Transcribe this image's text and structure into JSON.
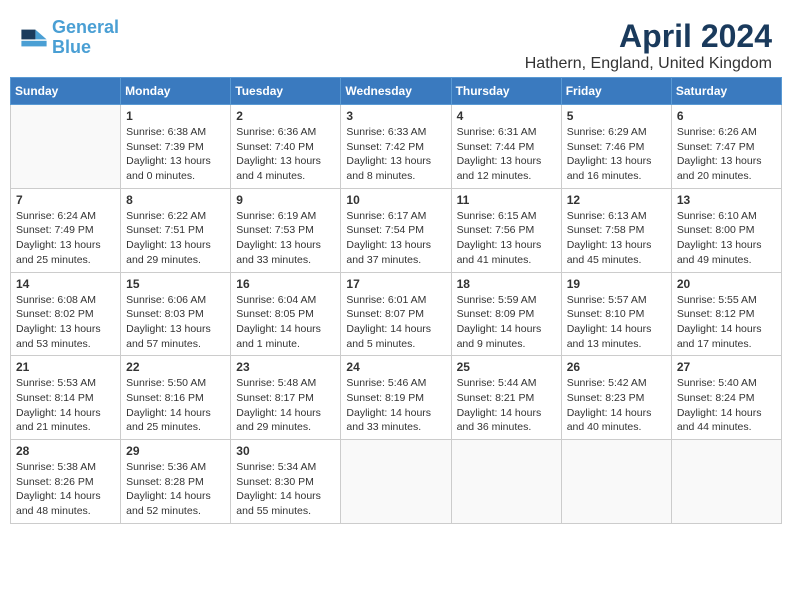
{
  "header": {
    "logo_line1": "General",
    "logo_line2": "Blue",
    "month": "April 2024",
    "location": "Hathern, England, United Kingdom"
  },
  "weekdays": [
    "Sunday",
    "Monday",
    "Tuesday",
    "Wednesday",
    "Thursday",
    "Friday",
    "Saturday"
  ],
  "weeks": [
    [
      {
        "day": "",
        "info": ""
      },
      {
        "day": "1",
        "info": "Sunrise: 6:38 AM\nSunset: 7:39 PM\nDaylight: 13 hours\nand 0 minutes."
      },
      {
        "day": "2",
        "info": "Sunrise: 6:36 AM\nSunset: 7:40 PM\nDaylight: 13 hours\nand 4 minutes."
      },
      {
        "day": "3",
        "info": "Sunrise: 6:33 AM\nSunset: 7:42 PM\nDaylight: 13 hours\nand 8 minutes."
      },
      {
        "day": "4",
        "info": "Sunrise: 6:31 AM\nSunset: 7:44 PM\nDaylight: 13 hours\nand 12 minutes."
      },
      {
        "day": "5",
        "info": "Sunrise: 6:29 AM\nSunset: 7:46 PM\nDaylight: 13 hours\nand 16 minutes."
      },
      {
        "day": "6",
        "info": "Sunrise: 6:26 AM\nSunset: 7:47 PM\nDaylight: 13 hours\nand 20 minutes."
      }
    ],
    [
      {
        "day": "7",
        "info": "Sunrise: 6:24 AM\nSunset: 7:49 PM\nDaylight: 13 hours\nand 25 minutes."
      },
      {
        "day": "8",
        "info": "Sunrise: 6:22 AM\nSunset: 7:51 PM\nDaylight: 13 hours\nand 29 minutes."
      },
      {
        "day": "9",
        "info": "Sunrise: 6:19 AM\nSunset: 7:53 PM\nDaylight: 13 hours\nand 33 minutes."
      },
      {
        "day": "10",
        "info": "Sunrise: 6:17 AM\nSunset: 7:54 PM\nDaylight: 13 hours\nand 37 minutes."
      },
      {
        "day": "11",
        "info": "Sunrise: 6:15 AM\nSunset: 7:56 PM\nDaylight: 13 hours\nand 41 minutes."
      },
      {
        "day": "12",
        "info": "Sunrise: 6:13 AM\nSunset: 7:58 PM\nDaylight: 13 hours\nand 45 minutes."
      },
      {
        "day": "13",
        "info": "Sunrise: 6:10 AM\nSunset: 8:00 PM\nDaylight: 13 hours\nand 49 minutes."
      }
    ],
    [
      {
        "day": "14",
        "info": "Sunrise: 6:08 AM\nSunset: 8:02 PM\nDaylight: 13 hours\nand 53 minutes."
      },
      {
        "day": "15",
        "info": "Sunrise: 6:06 AM\nSunset: 8:03 PM\nDaylight: 13 hours\nand 57 minutes."
      },
      {
        "day": "16",
        "info": "Sunrise: 6:04 AM\nSunset: 8:05 PM\nDaylight: 14 hours\nand 1 minute."
      },
      {
        "day": "17",
        "info": "Sunrise: 6:01 AM\nSunset: 8:07 PM\nDaylight: 14 hours\nand 5 minutes."
      },
      {
        "day": "18",
        "info": "Sunrise: 5:59 AM\nSunset: 8:09 PM\nDaylight: 14 hours\nand 9 minutes."
      },
      {
        "day": "19",
        "info": "Sunrise: 5:57 AM\nSunset: 8:10 PM\nDaylight: 14 hours\nand 13 minutes."
      },
      {
        "day": "20",
        "info": "Sunrise: 5:55 AM\nSunset: 8:12 PM\nDaylight: 14 hours\nand 17 minutes."
      }
    ],
    [
      {
        "day": "21",
        "info": "Sunrise: 5:53 AM\nSunset: 8:14 PM\nDaylight: 14 hours\nand 21 minutes."
      },
      {
        "day": "22",
        "info": "Sunrise: 5:50 AM\nSunset: 8:16 PM\nDaylight: 14 hours\nand 25 minutes."
      },
      {
        "day": "23",
        "info": "Sunrise: 5:48 AM\nSunset: 8:17 PM\nDaylight: 14 hours\nand 29 minutes."
      },
      {
        "day": "24",
        "info": "Sunrise: 5:46 AM\nSunset: 8:19 PM\nDaylight: 14 hours\nand 33 minutes."
      },
      {
        "day": "25",
        "info": "Sunrise: 5:44 AM\nSunset: 8:21 PM\nDaylight: 14 hours\nand 36 minutes."
      },
      {
        "day": "26",
        "info": "Sunrise: 5:42 AM\nSunset: 8:23 PM\nDaylight: 14 hours\nand 40 minutes."
      },
      {
        "day": "27",
        "info": "Sunrise: 5:40 AM\nSunset: 8:24 PM\nDaylight: 14 hours\nand 44 minutes."
      }
    ],
    [
      {
        "day": "28",
        "info": "Sunrise: 5:38 AM\nSunset: 8:26 PM\nDaylight: 14 hours\nand 48 minutes."
      },
      {
        "day": "29",
        "info": "Sunrise: 5:36 AM\nSunset: 8:28 PM\nDaylight: 14 hours\nand 52 minutes."
      },
      {
        "day": "30",
        "info": "Sunrise: 5:34 AM\nSunset: 8:30 PM\nDaylight: 14 hours\nand 55 minutes."
      },
      {
        "day": "",
        "info": ""
      },
      {
        "day": "",
        "info": ""
      },
      {
        "day": "",
        "info": ""
      },
      {
        "day": "",
        "info": ""
      }
    ]
  ]
}
